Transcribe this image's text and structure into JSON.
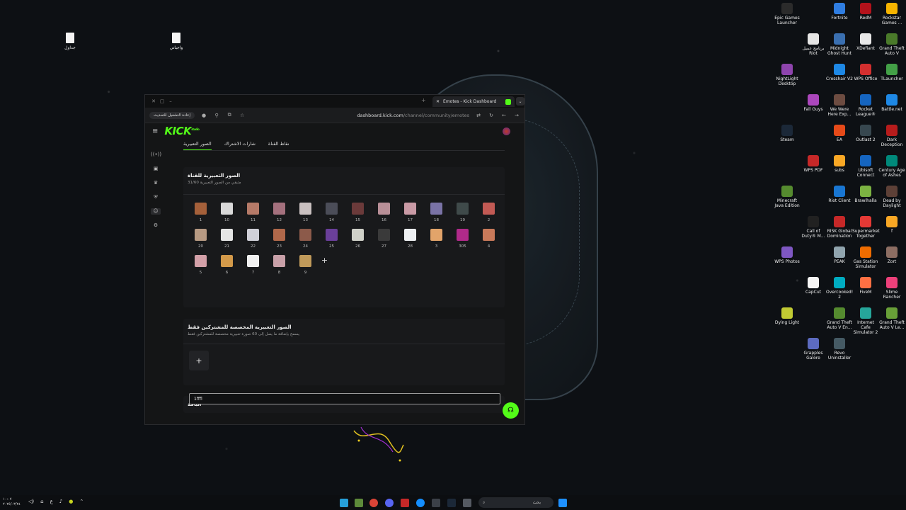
{
  "desktop": {
    "left_files": [
      {
        "label": "جداول"
      },
      {
        "label": "واجباتي"
      }
    ],
    "right_icons": [
      {
        "label": "Epic Games Launcher",
        "color": "#2b2b2b"
      },
      {
        "label": "Fortnite",
        "color": "#2f7de1"
      },
      {
        "label": "RedM",
        "color": "#b3121b"
      },
      {
        "label": "Rockstar Games ...",
        "color": "#f6b400"
      },
      {
        "label": "برنامج عميل Riot",
        "color": "#e5e5e5"
      },
      {
        "label": "Midnight Ghost Hunt",
        "color": "#3a6fb0"
      },
      {
        "label": "XDefiant",
        "color": "#e9e9e9"
      },
      {
        "label": "Grand Theft Auto V",
        "color": "#4a7a2a"
      },
      {
        "label": "NightLight Desktop",
        "color": "#8e44ad"
      },
      {
        "label": "Crosshair V2",
        "color": "#1e88e5"
      },
      {
        "label": "WPS Office",
        "color": "#d32f2f"
      },
      {
        "label": "TLauncher",
        "color": "#43a047"
      },
      {
        "label": "Fall Guys",
        "color": "#ab47bc"
      },
      {
        "label": "We Were Here Exp...",
        "color": "#6d4c41"
      },
      {
        "label": "Rocket League®",
        "color": "#1565c0"
      },
      {
        "label": "Battle.net",
        "color": "#1e88e5"
      },
      {
        "label": "Steam",
        "color": "#1b2838"
      },
      {
        "label": "EA",
        "color": "#e64a19"
      },
      {
        "label": "Outlast 2",
        "color": "#37474f"
      },
      {
        "label": "Dark Deception",
        "color": "#b71c1c"
      },
      {
        "label": "WPS PDF",
        "color": "#c62828"
      },
      {
        "label": "subs",
        "color": "#f9a825"
      },
      {
        "label": "Ubisoft Connect",
        "color": "#1565c0"
      },
      {
        "label": "Century Age of Ashes",
        "color": "#00897b"
      },
      {
        "label": "Minecraft Java Edition",
        "color": "#558b2f"
      },
      {
        "label": "Riot Client",
        "color": "#1976d2"
      },
      {
        "label": "Brawlhalla",
        "color": "#7cb342"
      },
      {
        "label": "Dead by Daylight",
        "color": "#5d4037"
      },
      {
        "label": "Call of Duty® M...",
        "color": "#212121"
      },
      {
        "label": "RISK Global Domination",
        "color": "#c62828"
      },
      {
        "label": "Supermarket Together",
        "color": "#e53935"
      },
      {
        "label": "f",
        "color": "#f9a825"
      },
      {
        "label": "WPS Photos",
        "color": "#7e57c2"
      },
      {
        "label": "PEAK",
        "color": "#90a4ae"
      },
      {
        "label": "Gas Station Simulator",
        "color": "#ef6c00"
      },
      {
        "label": "Zort",
        "color": "#8d6e63"
      },
      {
        "label": "CapCut",
        "color": "#f5f5f5"
      },
      {
        "label": "Overcooked! 2",
        "color": "#00acc1"
      },
      {
        "label": "FiveM",
        "color": "#ff7043"
      },
      {
        "label": "Slime Rancher",
        "color": "#ec407a"
      },
      {
        "label": "Dying Light",
        "color": "#c0ca33"
      },
      {
        "label": "Grand Theft Auto V En...",
        "color": "#558b2f"
      },
      {
        "label": "Internet Cafe Simulator 2",
        "color": "#26a69a"
      },
      {
        "label": "Grand Theft Auto V Le...",
        "color": "#689f38"
      },
      {
        "label": "Grapples Galore",
        "color": "#5c6bc0"
      },
      {
        "label": "Revo Uninstaller",
        "color": "#455a64"
      }
    ]
  },
  "browser": {
    "tab_title": "Emotes - Kick Dashboard",
    "reload_label": "إعادة التشغيل للتحديث",
    "url_host": "dashboard.kick.com",
    "url_path": "/channel/community/emotes"
  },
  "page": {
    "logo": "KICK",
    "logo_sup": "studio",
    "subtabs": [
      "الصور التعبيرية",
      "شارات الاشتراك",
      "نقاط القناة"
    ],
    "channel_emotes": {
      "title": "الصور التعبيرية للقناة",
      "subtitle": "متبقي من الصور التعبيرية 31/60",
      "emotes": [
        {
          "label": "1",
          "color": "#a5603a"
        },
        {
          "label": "10",
          "color": "#d9d9d9"
        },
        {
          "label": "11",
          "color": "#b67a68"
        },
        {
          "label": "12",
          "color": "#a4707d"
        },
        {
          "label": "13",
          "color": "#c9c0c0"
        },
        {
          "label": "14",
          "color": "#4b4d58"
        },
        {
          "label": "15",
          "color": "#6b3a3a"
        },
        {
          "label": "16",
          "color": "#b88f97"
        },
        {
          "label": "17",
          "color": "#c99aa5"
        },
        {
          "label": "18",
          "color": "#7a73a6"
        },
        {
          "label": "19",
          "color": "#3f4a4a"
        },
        {
          "label": "2",
          "color": "#c25a54"
        },
        {
          "label": "20",
          "color": "#b79a83"
        },
        {
          "label": "21",
          "color": "#e5e5e5"
        },
        {
          "label": "22",
          "color": "#d0d0d8"
        },
        {
          "label": "23",
          "color": "#b0684a"
        },
        {
          "label": "24",
          "color": "#8c5a4a"
        },
        {
          "label": "25",
          "color": "#6a3f9a"
        },
        {
          "label": "26",
          "color": "#cfd0c8"
        },
        {
          "label": "27",
          "color": "#3a3a3a"
        },
        {
          "label": "28",
          "color": "#eef0f2"
        },
        {
          "label": "3",
          "color": "#e2a46a"
        },
        {
          "label": "305",
          "color": "#b02a8a"
        },
        {
          "label": "4",
          "color": "#c97a5a"
        },
        {
          "label": "5",
          "color": "#d3a0a8"
        },
        {
          "label": "6",
          "color": "#d39a4a"
        },
        {
          "label": "7",
          "color": "#f0f0f0"
        },
        {
          "label": "8",
          "color": "#c8a0a8"
        },
        {
          "label": "9",
          "color": "#c09a5a"
        }
      ],
      "add_label": "+"
    },
    "subscriber_emotes": {
      "title": "الصور التعبيرية المخصصة للمشتركين فقط",
      "subtitle": "يسمح بإضافة ما يصل إلى 60 صورة تعبيرية مخصصة للمشتركين فقط",
      "add_label": "+"
    },
    "blocked": {
      "title": "الباقة",
      "input_value": "1fffl"
    }
  },
  "taskbar": {
    "search_placeholder": "بحث",
    "clock_time": "١٠:٠٧",
    "clock_date": "٢٠٢٥/٠٣/٢٤",
    "language": "ع"
  }
}
